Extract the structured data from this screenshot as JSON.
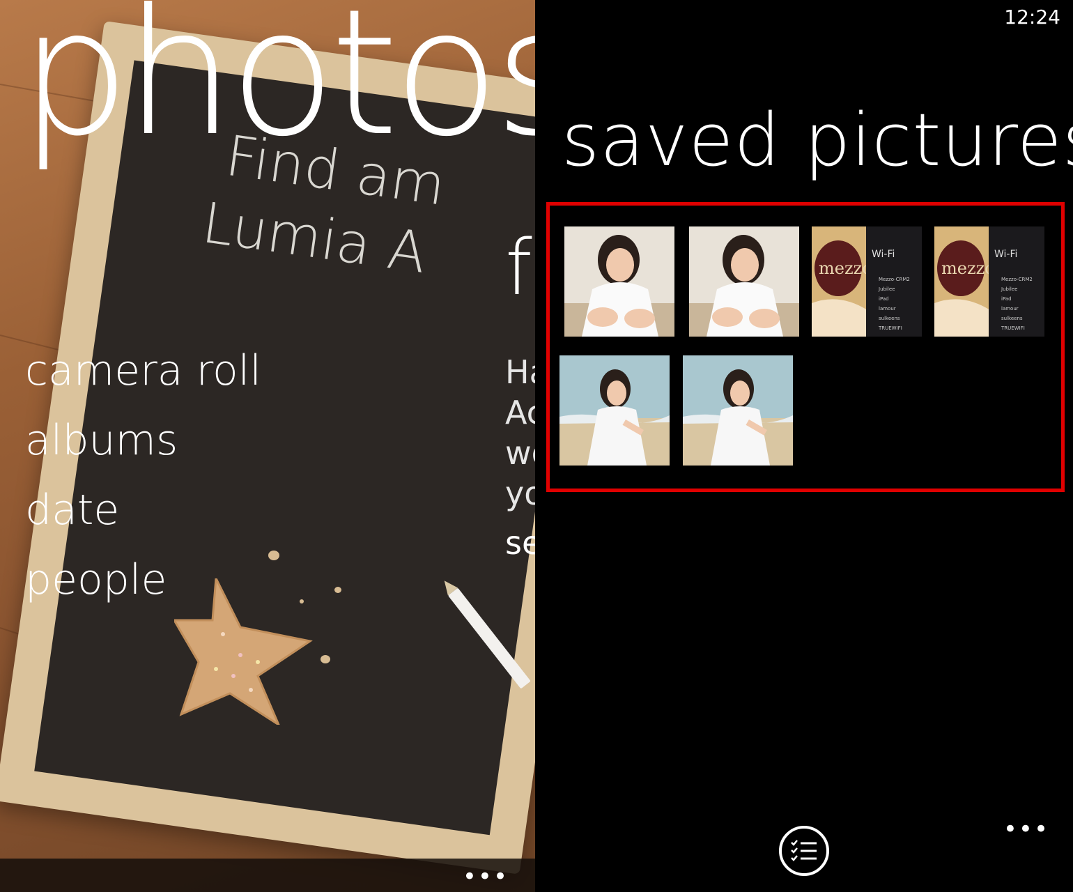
{
  "left_panel": {
    "hub_title": "photos",
    "chalk_line_1": "Find am",
    "chalk_line_2": "Lumia A",
    "peek_heading": "fe",
    "peek_lines": [
      "Ha",
      "Ac",
      "wo",
      "yo"
    ],
    "peek_link": "se",
    "menu": [
      "camera roll",
      "albums",
      "date",
      "people"
    ],
    "more_icon": "ellipsis-icon"
  },
  "right_panel": {
    "clock": "12:24",
    "title": "saved pictures",
    "thumbnails": [
      {
        "name": "photo-thumbnail-girl-white-dress-1"
      },
      {
        "name": "photo-thumbnail-girl-white-dress-2"
      },
      {
        "name": "photo-thumbnail-wifi-screenshot-1",
        "wifi_title": "Wi-Fi",
        "networks": [
          "Mezzo-CRM2",
          "Jubilee",
          "iPad",
          "lamour",
          "sulkeens",
          "TRUEWIFI"
        ],
        "cup_text": "mezzo"
      },
      {
        "name": "photo-thumbnail-wifi-screenshot-2",
        "wifi_title": "Wi-Fi",
        "networks": [
          "Mezzo-CRM2",
          "Jubilee",
          "iPad",
          "lamour",
          "sulkeens",
          "TRUEWIFI"
        ],
        "cup_text": "mezzo"
      },
      {
        "name": "photo-thumbnail-girl-beach-1"
      },
      {
        "name": "photo-thumbnail-girl-beach-2"
      }
    ],
    "select_icon": "select-list-icon",
    "more_icon": "ellipsis-icon",
    "colors": {
      "highlight": "#e00000",
      "background": "#000000",
      "text": "#ffffff"
    }
  }
}
